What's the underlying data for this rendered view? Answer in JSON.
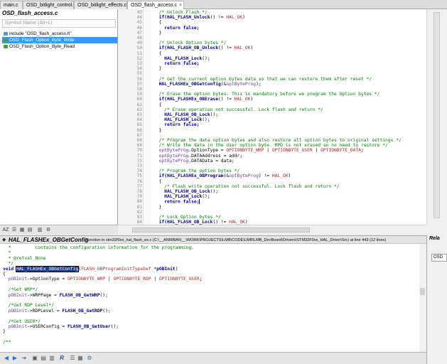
{
  "tabs": [
    {
      "label": "main.c",
      "active": false
    },
    {
      "label": "OSD_bitlight_control.c",
      "active": false
    },
    {
      "label": "OSD_bitlight_effects.c",
      "active": false
    },
    {
      "label": "OSD_flash_access.c",
      "active": true
    }
  ],
  "tab_close_glyph": "×",
  "symbol_panel": {
    "title": "OSD_flash_access.c",
    "search_placeholder": "Symbol Name (Alt+L)",
    "items": [
      {
        "label": "include \"OSD_flash_access.h\"",
        "icon": "include-icon",
        "selected": false
      },
      {
        "label": "OSD_Flash_Option_Byte_Write",
        "icon": "function-icon",
        "selected": true
      },
      {
        "label": "OSD_Flash_Option_Byte_Read",
        "icon": "function-icon",
        "selected": false
      }
    ]
  },
  "left_toolbar": {
    "buttons": [
      {
        "name": "sort-alpha-icon",
        "glyph": "AZ"
      },
      {
        "name": "list-view-icon",
        "glyph": "☰"
      },
      {
        "name": "grid-view-icon",
        "glyph": "▦"
      },
      {
        "name": "filter-icon",
        "glyph": "▤"
      },
      {
        "name": "book-icon",
        "glyph": "▥"
      },
      {
        "name": "settings-icon",
        "glyph": "⚙"
      }
    ]
  },
  "editor": {
    "lines": [
      {
        "n": "43",
        "s": [
          {
            "t": "  /* Unlock Flash */",
            "c": "cm"
          }
        ]
      },
      {
        "n": "44",
        "s": [
          {
            "t": "  if(",
            "c": "kw"
          },
          {
            "t": "HAL_FLASH_Unlock",
            "c": "fnc"
          },
          {
            "t": "() != ",
            "c": "plain"
          },
          {
            "t": "HAL_OK",
            "c": "mac"
          },
          {
            "t": ")",
            "c": "plain"
          }
        ]
      },
      {
        "n": "45",
        "s": [
          {
            "t": "  {",
            "c": "plain"
          }
        ]
      },
      {
        "n": "46",
        "s": [
          {
            "t": "    return false;",
            "c": "kw"
          }
        ]
      },
      {
        "n": "47",
        "s": [
          {
            "t": "  }",
            "c": "plain"
          }
        ]
      },
      {
        "n": "48",
        "s": []
      },
      {
        "n": "49",
        "s": [
          {
            "t": "  /* Unlock Option bytes */",
            "c": "cm"
          }
        ]
      },
      {
        "n": "50",
        "s": [
          {
            "t": "  if(",
            "c": "kw"
          },
          {
            "t": "HAL_FLASH_OB_Unlock",
            "c": "fnc"
          },
          {
            "t": "() != ",
            "c": "plain"
          },
          {
            "t": "HAL_OK",
            "c": "mac"
          },
          {
            "t": ")",
            "c": "plain"
          }
        ]
      },
      {
        "n": "51",
        "s": [
          {
            "t": "  {",
            "c": "plain"
          }
        ]
      },
      {
        "n": "52",
        "s": [
          {
            "t": "    ",
            "c": "plain"
          },
          {
            "t": "HAL_FLASH_Lock",
            "c": "fnc"
          },
          {
            "t": "();",
            "c": "plain"
          }
        ]
      },
      {
        "n": "53",
        "s": [
          {
            "t": "    return false;",
            "c": "kw"
          }
        ]
      },
      {
        "n": "54",
        "s": [
          {
            "t": "  }",
            "c": "plain"
          }
        ]
      },
      {
        "n": "55",
        "s": []
      },
      {
        "n": "56",
        "s": [
          {
            "t": "  /* Get the current option bytes data so that we can restore them after reset */",
            "c": "cm"
          }
        ]
      },
      {
        "n": "57",
        "s": [
          {
            "t": "  ",
            "c": "plain"
          },
          {
            "t": "HAL_FLASHEx_OBGetConfig",
            "c": "fnc"
          },
          {
            "t": "(&",
            "c": "plain"
          },
          {
            "t": "optByteProg",
            "c": "id"
          },
          {
            "t": ");",
            "c": "plain"
          }
        ]
      },
      {
        "n": "58",
        "s": []
      },
      {
        "n": "59",
        "s": [
          {
            "t": "  /* Erase the option bytes. This is mandatory before we program the Option bytes */",
            "c": "cm"
          }
        ]
      },
      {
        "n": "60",
        "s": [
          {
            "t": "  if(",
            "c": "kw"
          },
          {
            "t": "HAL_FLASHEx_OBErase",
            "c": "fnc"
          },
          {
            "t": "() != ",
            "c": "plain"
          },
          {
            "t": "HAL_OK",
            "c": "mac"
          },
          {
            "t": ")",
            "c": "plain"
          }
        ]
      },
      {
        "n": "61",
        "s": [
          {
            "t": "  {",
            "c": "plain"
          }
        ]
      },
      {
        "n": "62",
        "s": [
          {
            "t": "    /* Erase operation not successful. Lock flash and return */",
            "c": "cm"
          }
        ]
      },
      {
        "n": "63",
        "s": [
          {
            "t": "    ",
            "c": "plain"
          },
          {
            "t": "HAL_FLASH_OB_Lock",
            "c": "fnc"
          },
          {
            "t": "();",
            "c": "plain"
          }
        ]
      },
      {
        "n": "64",
        "s": [
          {
            "t": "    ",
            "c": "plain"
          },
          {
            "t": "HAL_FLASH_Lock",
            "c": "fnc"
          },
          {
            "t": "();",
            "c": "plain"
          }
        ]
      },
      {
        "n": "65",
        "s": [
          {
            "t": "    return false;",
            "c": "kw"
          }
        ]
      },
      {
        "n": "66",
        "s": [
          {
            "t": "  }",
            "c": "plain"
          }
        ]
      },
      {
        "n": "67",
        "s": []
      },
      {
        "n": "68",
        "s": [
          {
            "t": "  /* Program the data option bytes and also restore all option bytes to original settings */",
            "c": "cm"
          }
        ]
      },
      {
        "n": "69",
        "s": [
          {
            "t": "  /* Write the data in the User option byte. RPD is not erased so no need to restore */",
            "c": "cm"
          }
        ]
      },
      {
        "n": "70",
        "s": [
          {
            "t": "  optByteProg",
            "c": "id"
          },
          {
            "t": ".OptionType = ",
            "c": "plain"
          },
          {
            "t": "OPTIONBYTE_WRP",
            "c": "mac"
          },
          {
            "t": " | ",
            "c": "plain"
          },
          {
            "t": "OPTIONBYTE_USER",
            "c": "mac"
          },
          {
            "t": " | ",
            "c": "plain"
          },
          {
            "t": "OPTIONBYTE_DATA",
            "c": "mac"
          },
          {
            "t": ";",
            "c": "plain"
          }
        ]
      },
      {
        "n": "71",
        "s": [
          {
            "t": "  optByteProg",
            "c": "id"
          },
          {
            "t": ".DATAAddress = addr;",
            "c": "plain"
          }
        ]
      },
      {
        "n": "72",
        "s": [
          {
            "t": "  optByteProg",
            "c": "id"
          },
          {
            "t": ".DATAData = data;",
            "c": "plain"
          }
        ]
      },
      {
        "n": "73",
        "s": []
      },
      {
        "n": "74",
        "s": [
          {
            "t": "  /* Program the option bytes */",
            "c": "cm"
          }
        ]
      },
      {
        "n": "75",
        "s": [
          {
            "t": "  if(",
            "c": "kw"
          },
          {
            "t": "HAL_FLASHEx_OBProgram",
            "c": "fnc"
          },
          {
            "t": "(&",
            "c": "plain"
          },
          {
            "t": "optByteProg",
            "c": "id"
          },
          {
            "t": ") != ",
            "c": "plain"
          },
          {
            "t": "HAL_OK",
            "c": "mac"
          },
          {
            "t": ")",
            "c": "plain"
          }
        ]
      },
      {
        "n": "76",
        "s": [
          {
            "t": "  {",
            "c": "plain"
          }
        ]
      },
      {
        "n": "77",
        "s": [
          {
            "t": "    /* Flash write operation not successful. Lock flash and return */",
            "c": "cm"
          }
        ]
      },
      {
        "n": "78",
        "s": [
          {
            "t": "    ",
            "c": "plain"
          },
          {
            "t": "HAL_FLASH_OB_Lock",
            "c": "fnc"
          },
          {
            "t": "();",
            "c": "plain"
          }
        ]
      },
      {
        "n": "79",
        "s": [
          {
            "t": "    ",
            "c": "plain"
          },
          {
            "t": "HAL_FLASH_Lock",
            "c": "fnc"
          },
          {
            "t": "();",
            "c": "plain"
          }
        ]
      },
      {
        "n": "80",
        "s": [
          {
            "t": "    return false;",
            "c": "kw"
          }
        ],
        "cursor": true
      },
      {
        "n": "81",
        "s": [
          {
            "t": "  }",
            "c": "plain"
          }
        ]
      },
      {
        "n": "82",
        "s": []
      },
      {
        "n": "83",
        "s": [
          {
            "t": "  /* Lock Option bytes */",
            "c": "cm"
          }
        ]
      },
      {
        "n": "84",
        "s": [
          {
            "t": "  if(",
            "c": "kw"
          },
          {
            "t": "HAL_FLASH_OB_Lock",
            "c": "fnc"
          },
          {
            "t": "() != ",
            "c": "plain"
          },
          {
            "t": "HAL_OK",
            "c": "mac"
          },
          {
            "t": ")",
            "c": "plain"
          }
        ]
      },
      {
        "n": "85",
        "s": [
          {
            "t": "  {",
            "c": "plain"
          }
        ]
      }
    ]
  },
  "context_window": {
    "symbol_name": "HAL_FLASHEx_OBGetConfig",
    "info": "Function in stm32f0xx_hal_flash_ex.c (C:\\__ANIRBAN__\\WORK\\PROJECTS\\LMB\\CODE\\LMB\\LMB_DevBoard\\Drivers\\STM32F0xx_HAL_Driver\\Src) at line 443 (12 lines)",
    "lines": [
      {
        "s": [
          {
            "t": "  *         contains the configuration information for the programming.",
            "c": "cm"
          }
        ]
      },
      {
        "s": [
          {
            "t": "  *",
            "c": "cm"
          }
        ]
      },
      {
        "s": [
          {
            "t": "  * @retval None",
            "c": "cm"
          }
        ]
      },
      {
        "s": [
          {
            "t": "  */",
            "c": "cm"
          }
        ]
      },
      {
        "s": [
          {
            "t": "void ",
            "c": "kw"
          },
          {
            "t": "HAL_FLASHEx_OBGetConfig",
            "c": "hl"
          },
          {
            "t": "(",
            "c": "plain"
          },
          {
            "t": "FLASH_OBProgramInitTypeDef",
            "c": "mac"
          },
          {
            "t": " *",
            "c": "plain"
          },
          {
            "t": "pOBInit",
            "c": "fnc"
          },
          {
            "t": ")",
            "c": "plain"
          }
        ]
      },
      {
        "s": [
          {
            "t": "{",
            "c": "plain"
          }
        ]
      },
      {
        "s": [
          {
            "t": "  pOBInit",
            "c": "id"
          },
          {
            "t": "->OptionType = ",
            "c": "plain"
          },
          {
            "t": "OPTIONBYTE_WRP",
            "c": "mac"
          },
          {
            "t": " | ",
            "c": "plain"
          },
          {
            "t": "OPTIONBYTE_RDP",
            "c": "mac"
          },
          {
            "t": " | ",
            "c": "plain"
          },
          {
            "t": "OPTIONBYTE_USER",
            "c": "mac"
          },
          {
            "t": ";",
            "c": "plain"
          }
        ]
      },
      {
        "s": []
      },
      {
        "s": [
          {
            "t": "  /*Get WRP*/",
            "c": "cm"
          }
        ]
      },
      {
        "s": [
          {
            "t": "  pOBInit",
            "c": "id"
          },
          {
            "t": "->WRPPage = ",
            "c": "plain"
          },
          {
            "t": "FLASH_OB_GetWRP",
            "c": "fnc"
          },
          {
            "t": "();",
            "c": "plain"
          }
        ]
      },
      {
        "s": []
      },
      {
        "s": [
          {
            "t": "  /*Get RDP Level*/",
            "c": "cm"
          }
        ]
      },
      {
        "s": [
          {
            "t": "  pOBInit",
            "c": "id"
          },
          {
            "t": "->RDPLevel = ",
            "c": "plain"
          },
          {
            "t": "FLASH_OB_GetRDP",
            "c": "fnc"
          },
          {
            "t": "();",
            "c": "plain"
          }
        ]
      },
      {
        "s": []
      },
      {
        "s": [
          {
            "t": "  /*Get USER*/",
            "c": "cm"
          }
        ]
      },
      {
        "s": [
          {
            "t": "  pOBInit",
            "c": "id"
          },
          {
            "t": "->USERConfig = ",
            "c": "plain"
          },
          {
            "t": "FLASH_OB_GetUser",
            "c": "fnc"
          },
          {
            "t": "();",
            "c": "plain"
          }
        ]
      },
      {
        "s": [
          {
            "t": "}",
            "c": "plain"
          }
        ]
      },
      {
        "s": []
      },
      {
        "s": [
          {
            "t": "/**",
            "c": "cm"
          }
        ]
      }
    ]
  },
  "bottom_toolbar": {
    "buttons": [
      {
        "name": "back-icon",
        "glyph": "◀",
        "color": "#2a6fc9"
      },
      {
        "name": "forward-icon",
        "glyph": "▶",
        "color": "#2a6fc9"
      },
      {
        "name": "jump-icon",
        "glyph": "➜",
        "color": "#2a6fc9"
      },
      {
        "name": "lock-icon",
        "glyph": "▣",
        "color": "#555555"
      },
      {
        "name": "save-icon",
        "glyph": "▤",
        "color": "#555555"
      },
      {
        "name": "print-icon",
        "glyph": "▥",
        "color": "#555555"
      },
      {
        "name": "references-icon",
        "glyph": "R",
        "color": "#1f4e96"
      },
      {
        "name": "list-icon",
        "glyph": "☰",
        "color": "#555555"
      },
      {
        "name": "book-icon",
        "glyph": "▦",
        "color": "#555555"
      },
      {
        "name": "settings-icon",
        "glyph": "⚙",
        "color": "#3a6fc0"
      }
    ]
  },
  "right_panel": {
    "title": "Rela",
    "item": "OSD"
  }
}
